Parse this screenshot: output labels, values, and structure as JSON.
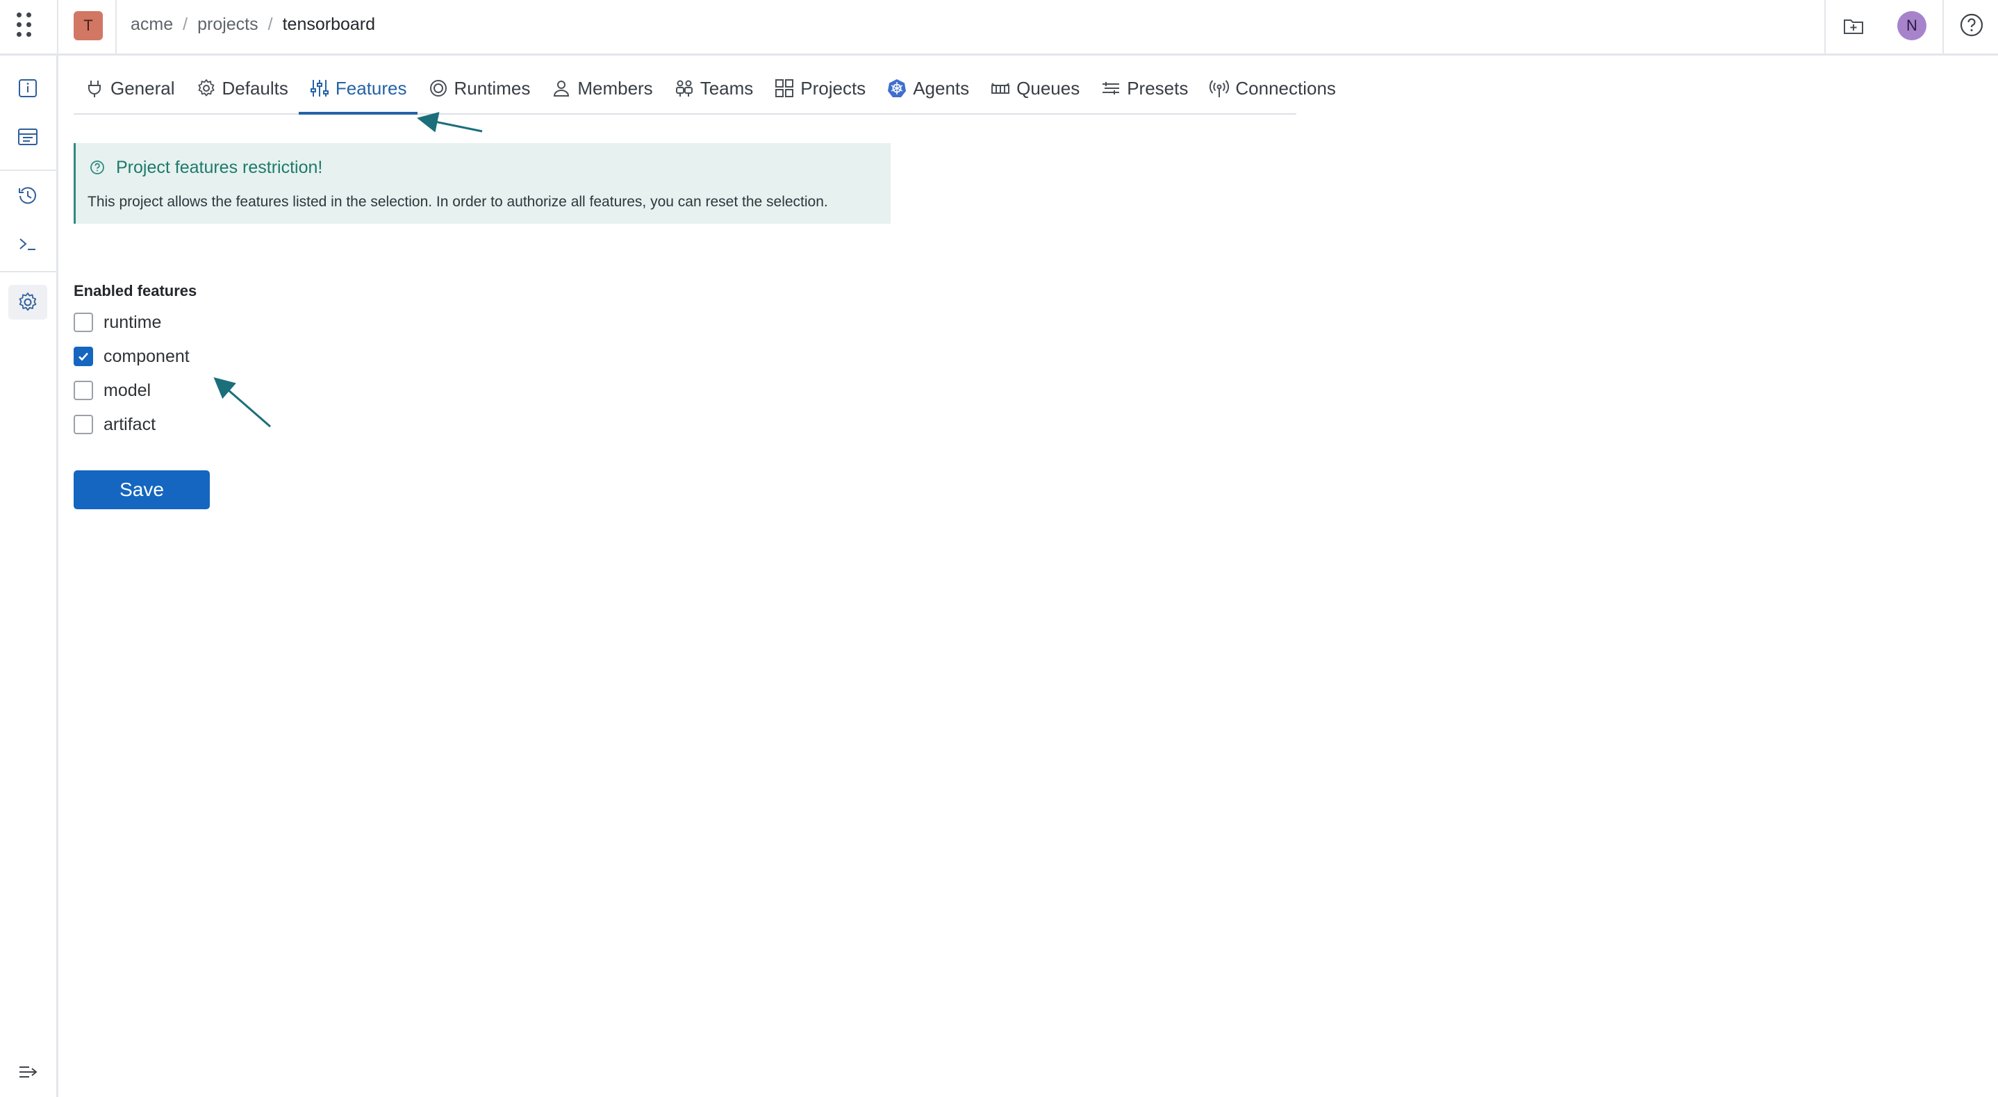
{
  "topbar": {
    "project_initial": "T",
    "breadcrumb": [
      "acme",
      "projects",
      "tensorboard"
    ],
    "user_initial": "N",
    "icons": [
      "app-launcher-icon",
      "new-folder-icon",
      "help-icon"
    ]
  },
  "sidebar": {
    "items": [
      "info-icon",
      "dashboard-icon",
      "history-icon",
      "terminal-icon",
      "settings-icon"
    ],
    "active": "settings-icon",
    "footer": "expand-sidebar-icon"
  },
  "tabs": [
    {
      "label": "General",
      "icon": "plug-icon"
    },
    {
      "label": "Defaults",
      "icon": "gear-icon"
    },
    {
      "label": "Features",
      "icon": "sliders-icon",
      "active": true
    },
    {
      "label": "Runtimes",
      "icon": "target-icon"
    },
    {
      "label": "Members",
      "icon": "person-icon"
    },
    {
      "label": "Teams",
      "icon": "teams-icon"
    },
    {
      "label": "Projects",
      "icon": "grid-icon"
    },
    {
      "label": "Agents",
      "icon": "kubernetes-icon"
    },
    {
      "label": "Queues",
      "icon": "queue-icon"
    },
    {
      "label": "Presets",
      "icon": "presets-icon"
    },
    {
      "label": "Connections",
      "icon": "broadcast-icon"
    }
  ],
  "alert": {
    "title": "Project features restriction!",
    "message": "This project allows the features listed in the selection. In order to authorize all features, you can reset the selection."
  },
  "form": {
    "section_label": "Enabled features",
    "features": [
      {
        "label": "runtime",
        "checked": false
      },
      {
        "label": "component",
        "checked": true
      },
      {
        "label": "model",
        "checked": false
      },
      {
        "label": "artifact",
        "checked": false
      }
    ],
    "save_label": "Save"
  },
  "colors": {
    "primary": "#1466c0",
    "tab_active": "#2463a6",
    "alert_bg": "#e6f1f0",
    "alert_text": "#1f7a6b",
    "annotation_arrow": "#1b6f7a"
  }
}
